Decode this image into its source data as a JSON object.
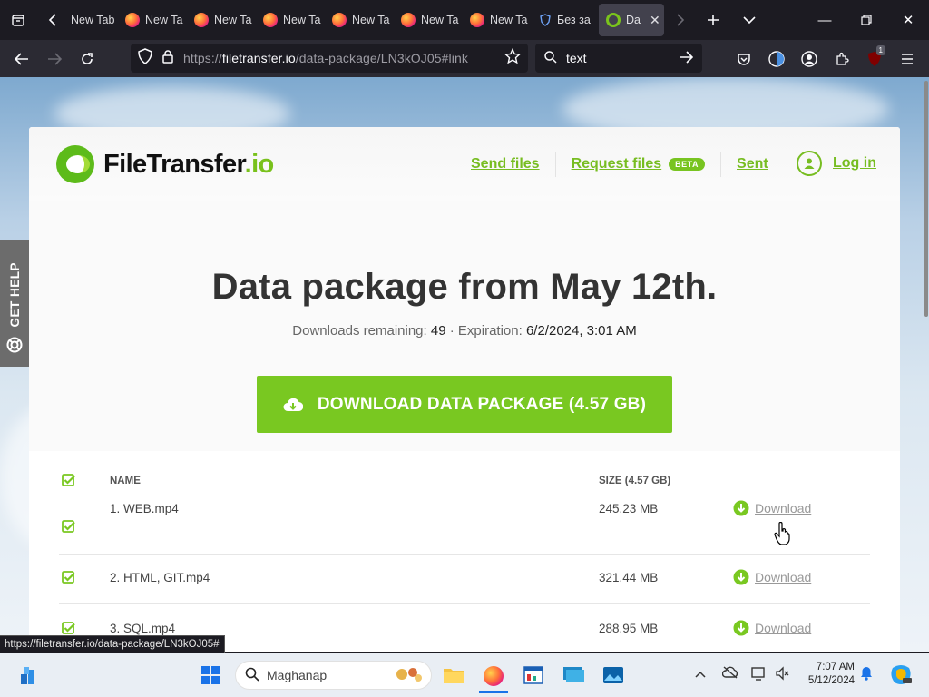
{
  "browser": {
    "tabs": [
      {
        "label": "New Tab",
        "icon": "firefox-icon"
      },
      {
        "label": "New Tab",
        "icon": "firefox-icon"
      },
      {
        "label": "New Tab",
        "icon": "firefox-icon"
      },
      {
        "label": "New Tab",
        "icon": "firefox-icon"
      },
      {
        "label": "New Tab",
        "icon": "firefox-icon"
      },
      {
        "label": "New Tab",
        "icon": "firefox-icon"
      },
      {
        "label": "New Tab",
        "icon": "firefox-icon"
      },
      {
        "label": "Без за",
        "icon": "shield-icon"
      },
      {
        "label": "Da",
        "icon": "filetransfer-icon"
      }
    ],
    "url_prefix": "https://",
    "url_host": "filetransfer.io",
    "url_path": "/data-package/LN3kOJ05#link",
    "search_text": "text",
    "extension_badge": "1"
  },
  "site": {
    "logo_main": "FileTransfer",
    "logo_suffix": ".io",
    "nav": {
      "send": "Send files",
      "request": "Request files",
      "beta": "BETA",
      "sent": "Sent",
      "login": "Log in"
    },
    "help": "GET HELP"
  },
  "package": {
    "title": "Data package from May 12th.",
    "downloads_label": "Downloads remaining:",
    "downloads_value": "49",
    "sep": "·",
    "expiration_label": "Expiration:",
    "expiration_value": "6/2/2024, 3:01 AM",
    "download_button": "DOWNLOAD DATA PACKAGE (4.57 GB)"
  },
  "files": {
    "col_name": "NAME",
    "col_size": "SIZE (4.57 GB)",
    "download_label": "Download",
    "rows": [
      {
        "name": "1. WEB.mp4",
        "size": "245.23 MB"
      },
      {
        "name": "2. HTML, GIT.mp4",
        "size": "321.44 MB"
      },
      {
        "name": "3. SQL.mp4",
        "size": "288.95 MB"
      }
    ]
  },
  "status_url": "https://filetransfer.io/data-package/LN3kOJ05#",
  "taskbar": {
    "search_placeholder": "Maghanap",
    "time": "7:07 AM",
    "date": "5/12/2024"
  },
  "colors": {
    "brand_green": "#79c821",
    "link_green": "#77bd21",
    "browser_dark": "#1c1b22"
  }
}
